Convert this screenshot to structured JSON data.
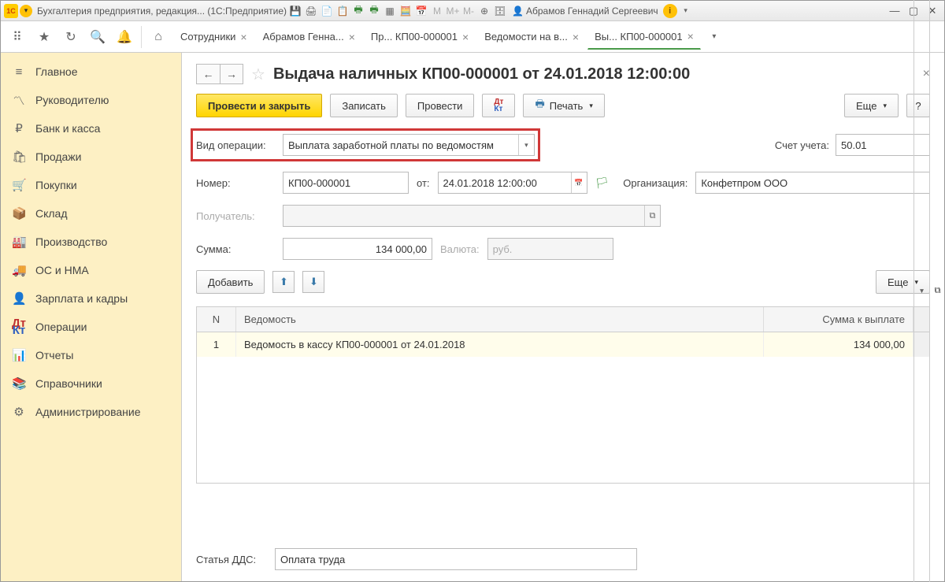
{
  "titlebar": {
    "app_title": "Бухгалтерия предприятия, редакция... (1С:Предприятие)",
    "user": "Абрамов Геннадий Сергеевич"
  },
  "tabs": [
    {
      "label": "Сотрудники"
    },
    {
      "label": "Абрамов Генна..."
    },
    {
      "label": "Пр... КП00-000001"
    },
    {
      "label": "Ведомости на в..."
    },
    {
      "label": "Вы... КП00-000001",
      "active": true
    }
  ],
  "sidebar": [
    {
      "icon": "≡",
      "label": "Главное"
    },
    {
      "icon": "〽",
      "label": "Руководителю"
    },
    {
      "icon": "₽",
      "label": "Банк и касса"
    },
    {
      "icon": "🛍",
      "label": "Продажи"
    },
    {
      "icon": "🛒",
      "label": "Покупки"
    },
    {
      "icon": "📦",
      "label": "Склад"
    },
    {
      "icon": "🏭",
      "label": "Производство"
    },
    {
      "icon": "🚚",
      "label": "ОС и НМА"
    },
    {
      "icon": "👤",
      "label": "Зарплата и кадры"
    },
    {
      "icon": "ДтКт",
      "label": "Операции"
    },
    {
      "icon": "📊",
      "label": "Отчеты"
    },
    {
      "icon": "📚",
      "label": "Справочники"
    },
    {
      "icon": "⚙",
      "label": "Администрирование"
    }
  ],
  "doc": {
    "title": "Выдача наличных КП00-000001 от 24.01.2018 12:00:00",
    "actions": {
      "post_close": "Провести и закрыть",
      "save": "Записать",
      "post": "Провести",
      "print": "Печать",
      "more": "Еще",
      "help": "?",
      "add": "Добавить"
    },
    "labels": {
      "op_type": "Вид операции:",
      "account": "Счет учета:",
      "number": "Номер:",
      "from": "от:",
      "org": "Организация:",
      "recipient": "Получатель:",
      "sum": "Сумма:",
      "currency": "Валюта:",
      "dds": "Статья ДДС:"
    },
    "values": {
      "op_type": "Выплата заработной платы по ведомостям",
      "account": "50.01",
      "number": "КП00-000001",
      "date": "24.01.2018 12:00:00",
      "org": "Конфетпром ООО",
      "recipient": "",
      "sum": "134 000,00",
      "currency": "руб.",
      "dds": "Оплата труда"
    },
    "table": {
      "headers": {
        "n": "N",
        "vedomost": "Ведомость",
        "sum": "Сумма к выплате"
      },
      "rows": [
        {
          "n": "1",
          "vedomost": "Ведомость в кассу КП00-000001 от 24.01.2018",
          "sum": "134 000,00"
        }
      ]
    }
  }
}
